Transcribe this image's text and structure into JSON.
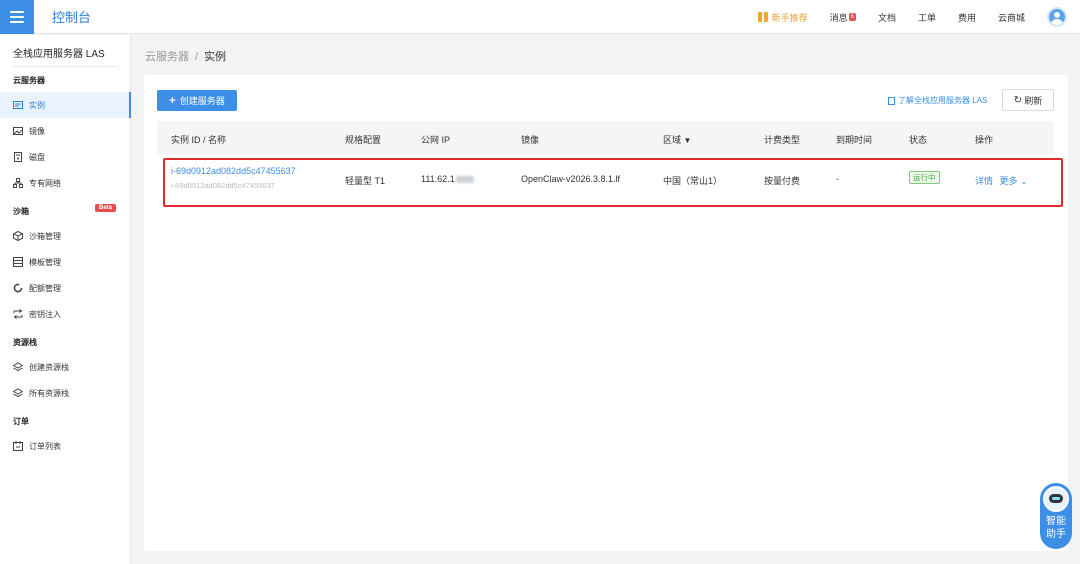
{
  "topbar": {
    "brand": "控制台",
    "newbie": "新手推荐",
    "message": "消息",
    "message_badge": "6",
    "docs": "文档",
    "ticket": "工单",
    "billing": "费用",
    "store": "云商城"
  },
  "sidebar": {
    "title": "全栈应用服务器 LAS",
    "group_cloud": "云服务器",
    "items_cloud": [
      "实例",
      "镜像",
      "磁盘",
      "专有网络"
    ],
    "group_sandbox": "沙箱",
    "beta": "Beta",
    "items_sandbox": [
      "沙箱管理",
      "模板管理",
      "配额管理",
      "密钥注入"
    ],
    "group_stack": "资源栈",
    "items_stack": [
      "创建资源栈",
      "所有资源栈"
    ],
    "group_order": "订单",
    "items_order": [
      "订单列表"
    ]
  },
  "breadcrumb": {
    "parent": "云服务器",
    "separator": "/",
    "current": "实例"
  },
  "toolbar": {
    "create_label": "创建服务器",
    "learn_link": "了解全栈应用服务器 LAS",
    "refresh_label": "刷新"
  },
  "table": {
    "headers": [
      "实例 ID / 名称",
      "规格配置",
      "公网 IP",
      "镜像",
      "区域",
      "计费类型",
      "到期时间",
      "状态",
      "操作"
    ],
    "rows": [
      {
        "id": "i-69d0912ad082dd5c47455637",
        "name": "i-69d0912ad082dd5c47455637",
        "spec": "轻量型 T1",
        "ip_prefix": "111.62.1",
        "image": "OpenClaw-v2026.3.8.1.lf",
        "region": "中国（常山1）",
        "billing": "按量付费",
        "expire": "-",
        "status": "运行中",
        "op_detail": "详情",
        "op_more": "更多"
      }
    ]
  },
  "assistant": {
    "label": "智能助手"
  },
  "colors": {
    "accent": "#3d8ee6",
    "highlight": "#e02c2c",
    "status_green": "#3fb032"
  }
}
